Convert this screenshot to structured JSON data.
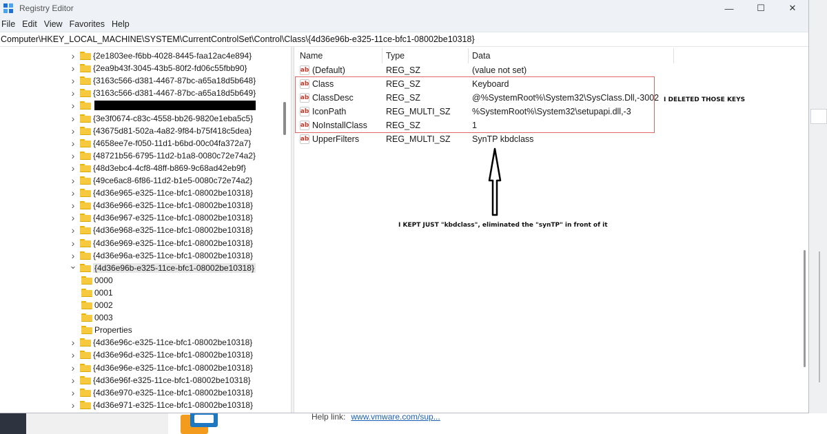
{
  "window": {
    "title": "Registry Editor",
    "controls": {
      "minimize": "—",
      "maximize": "☐",
      "close": "✕"
    }
  },
  "menu": [
    "File",
    "Edit",
    "View",
    "Favorites",
    "Help"
  ],
  "address": "Computer\\HKEY_LOCAL_MACHINE\\SYSTEM\\CurrentControlSet\\Control\\Class\\{4d36e96b-e325-11ce-bfc1-08002be10318}",
  "tree": {
    "items": [
      {
        "label": "{2e1803ee-f6bb-4028-8445-faa12ac4e894}",
        "state": "collapsed"
      },
      {
        "label": "{2ea9b43f-3045-43b5-80f2-fd06c55fbb90}",
        "state": "collapsed"
      },
      {
        "label": "{3163c566-d381-4467-87bc-a65a18d5b648}",
        "state": "collapsed"
      },
      {
        "label": "{3163c566-d381-4467-87bc-a65a18d5b649}",
        "state": "collapsed"
      },
      {
        "label": "",
        "state": "collapsed",
        "redacted": true
      },
      {
        "label": "{3e3f0674-c83c-4558-bb26-9820e1eba5c5}",
        "state": "collapsed"
      },
      {
        "label": "{43675d81-502a-4a82-9f84-b75f418c5dea}",
        "state": "collapsed"
      },
      {
        "label": "{4658ee7e-f050-11d1-b6bd-00c04fa372a7}",
        "state": "collapsed"
      },
      {
        "label": "{48721b56-6795-11d2-b1a8-0080c72e74a2}",
        "state": "collapsed"
      },
      {
        "label": "{48d3ebc4-4cf8-48ff-b869-9c68ad42eb9f}",
        "state": "collapsed"
      },
      {
        "label": "{49ce6ac8-6f86-11d2-b1e5-0080c72e74a2}",
        "state": "collapsed"
      },
      {
        "label": "{4d36e965-e325-11ce-bfc1-08002be10318}",
        "state": "collapsed"
      },
      {
        "label": "{4d36e966-e325-11ce-bfc1-08002be10318}",
        "state": "collapsed"
      },
      {
        "label": "{4d36e967-e325-11ce-bfc1-08002be10318}",
        "state": "collapsed"
      },
      {
        "label": "{4d36e968-e325-11ce-bfc1-08002be10318}",
        "state": "collapsed"
      },
      {
        "label": "{4d36e969-e325-11ce-bfc1-08002be10318}",
        "state": "collapsed"
      },
      {
        "label": "{4d36e96a-e325-11ce-bfc1-08002be10318}",
        "state": "collapsed"
      },
      {
        "label": "{4d36e96b-e325-11ce-bfc1-08002be10318}",
        "state": "expanded",
        "selected": true
      },
      {
        "label": "0000",
        "state": "leaf",
        "child": true
      },
      {
        "label": "0001",
        "state": "leaf",
        "child": true
      },
      {
        "label": "0002",
        "state": "leaf",
        "child": true
      },
      {
        "label": "0003",
        "state": "leaf",
        "child": true
      },
      {
        "label": "Properties",
        "state": "leaf",
        "child": true
      },
      {
        "label": "{4d36e96c-e325-11ce-bfc1-08002be10318}",
        "state": "collapsed"
      },
      {
        "label": "{4d36e96d-e325-11ce-bfc1-08002be10318}",
        "state": "collapsed"
      },
      {
        "label": "{4d36e96e-e325-11ce-bfc1-08002be10318}",
        "state": "collapsed"
      },
      {
        "label": "{4d36e96f-e325-11ce-bfc1-08002be10318}",
        "state": "collapsed"
      },
      {
        "label": "{4d36e970-e325-11ce-bfc1-08002be10318}",
        "state": "collapsed"
      },
      {
        "label": "{4d36e971-e325-11ce-bfc1-08002be10318}",
        "state": "collapsed"
      }
    ]
  },
  "list": {
    "columns": {
      "name": "Name",
      "type": "Type",
      "data": "Data"
    },
    "values": [
      {
        "name": "(Default)",
        "type": "REG_SZ",
        "data": "(value not set)"
      },
      {
        "name": "Class",
        "type": "REG_SZ",
        "data": "Keyboard"
      },
      {
        "name": "ClassDesc",
        "type": "REG_SZ",
        "data": "@%SystemRoot%\\System32\\SysClass.Dll,-3002"
      },
      {
        "name": "IconPath",
        "type": "REG_MULTI_SZ",
        "data": "%SystemRoot%\\System32\\setupapi.dll,-3"
      },
      {
        "name": "NoInstallClass",
        "type": "REG_SZ",
        "data": "1"
      },
      {
        "name": "UpperFilters",
        "type": "REG_MULTI_SZ",
        "data": "SynTP kbdclass"
      }
    ],
    "value_icon_text": "ab"
  },
  "annotations": {
    "deleted_note": "I DELETED THOSE KEYS",
    "kept_note": "I KEPT JUST \"kbdclass\", eliminated the \"synTP\" in front of it",
    "box_color": "#e06666"
  },
  "background": {
    "help_label": "Help link:",
    "help_url": "www.vmware.com/sup..."
  },
  "icons": {
    "app": "registry-editor-icon",
    "folder": "folder-icon",
    "value": "string-value-icon"
  }
}
